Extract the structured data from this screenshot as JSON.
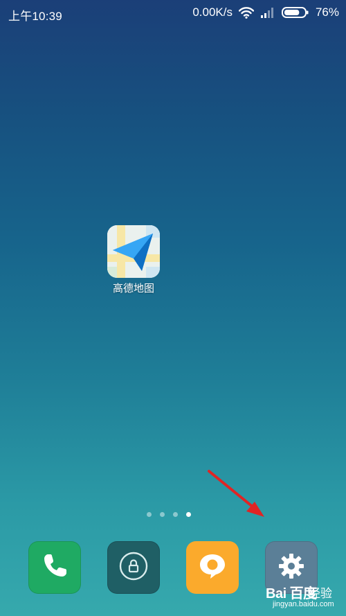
{
  "status_bar": {
    "time": "上午10:39",
    "network_speed": "0.00K/s",
    "battery_percent": "76%",
    "battery_level": 0.76,
    "icons": [
      "wifi-icon",
      "signal-icon",
      "battery-icon"
    ]
  },
  "home_screen": {
    "apps": [
      {
        "label": "高德地图",
        "icon": "amap-icon"
      }
    ],
    "page_indicator": {
      "count": 4,
      "active_index": 3
    }
  },
  "dock": {
    "apps": [
      {
        "icon": "phone-icon",
        "color": "#1faa63"
      },
      {
        "icon": "security-icon",
        "color": "#1f5f65"
      },
      {
        "icon": "messages-icon",
        "color": "#fbaa2c"
      },
      {
        "icon": "settings-gear-icon",
        "color": "#5b7f97"
      }
    ]
  },
  "annotation": {
    "icon": "red-arrow-icon",
    "color": "#e02424"
  },
  "watermark": {
    "brand": "Bai 百度",
    "cn": "经验",
    "url": "jingyan.baidu.com"
  }
}
